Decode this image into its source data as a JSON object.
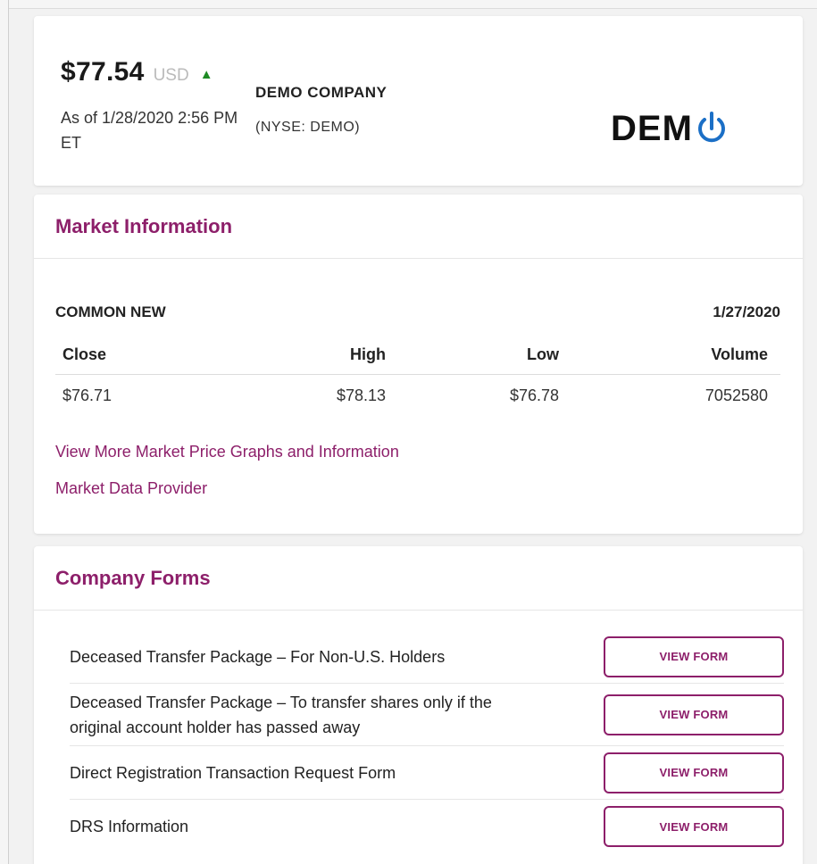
{
  "quote": {
    "price": "$77.54",
    "currency": "USD",
    "change_direction": "up",
    "arrow_glyph": "▲",
    "arrow_color": "#1e8a24",
    "as_of": "As of 1/28/2020 2:56 PM ET",
    "company_name": "DEMO COMPANY",
    "ticker": "(NYSE: DEMO)",
    "logo_text": "DEM",
    "logo_icon": "power-icon",
    "logo_icon_color": "#1b6fc6"
  },
  "market": {
    "title": "Market Information",
    "security_name": "COMMON NEW",
    "date": "1/27/2020",
    "columns": [
      "Close",
      "High",
      "Low",
      "Volume"
    ],
    "values": [
      "$76.71",
      "$78.13",
      "$76.78",
      "7052580"
    ],
    "links": {
      "graphs": "View More Market Price Graphs and Information",
      "provider": "Market Data Provider"
    }
  },
  "forms": {
    "title": "Company Forms",
    "button_label": "VIEW FORM",
    "items": [
      {
        "label": "Deceased Transfer Package – For Non-U.S. Holders"
      },
      {
        "label": "Deceased Transfer Package – To transfer shares only if the original account holder has passed away"
      },
      {
        "label": "Direct Registration Transaction Request Form"
      },
      {
        "label": "DRS Information"
      }
    ]
  },
  "colors": {
    "accent": "#8d1f6a",
    "background": "#f2f2f2",
    "card": "#ffffff"
  }
}
